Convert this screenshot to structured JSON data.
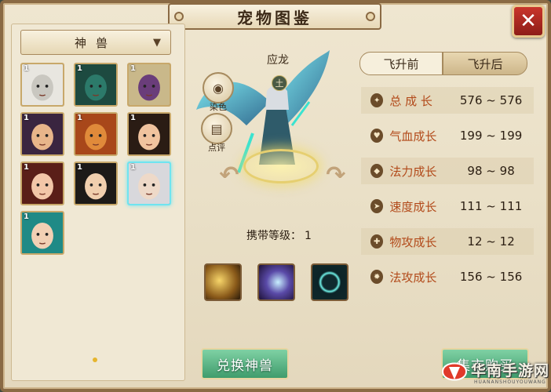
{
  "window": {
    "title": "宠物图鉴",
    "close_label": "✕"
  },
  "left": {
    "category": "神兽",
    "pets": [
      {
        "level": "1",
        "color": "#c9c7c0",
        "hair": "#e8e6e0"
      },
      {
        "level": "1",
        "color": "#2c7a6a",
        "hair": "#1d4a40"
      },
      {
        "level": "1",
        "color": "#6a3d7a",
        "hair": "#c9b88a"
      },
      {
        "level": "1",
        "color": "#e8b58a",
        "hair": "#3a2540"
      },
      {
        "level": "1",
        "color": "#e08a3a",
        "hair": "#a8471a"
      },
      {
        "level": "1",
        "color": "#f0c39e",
        "hair": "#2a1c14"
      },
      {
        "level": "1",
        "color": "#f2c6a8",
        "hair": "#5a1e18"
      },
      {
        "level": "1",
        "color": "#f1cfae",
        "hair": "#1d1a18"
      },
      {
        "level": "1",
        "color": "#eed9c8",
        "hair": "#d8d8dc",
        "selected": true
      },
      {
        "level": "1",
        "color": "#f2d0b4",
        "hair": "#1f8a86"
      }
    ]
  },
  "middle": {
    "pet_name": "应龙",
    "element_badge": "土",
    "dye_label": "染色",
    "review_label": "点评",
    "carry_label": "携带等级：",
    "carry_value": "1",
    "exchange_label": "兑换神兽",
    "market_label": "集市购买"
  },
  "right": {
    "tabs": [
      "飞升前",
      "飞升后"
    ],
    "active_tab": "飞升后",
    "stats": [
      {
        "name": "总 成 长",
        "min": "576",
        "sep": "~",
        "max": "576"
      },
      {
        "name": "气血成长",
        "min": "199",
        "sep": "~",
        "max": "199"
      },
      {
        "name": "法力成长",
        "min": "98",
        "sep": "~",
        "max": "98"
      },
      {
        "name": "速度成长",
        "min": "111",
        "sep": "~",
        "max": "111"
      },
      {
        "name": "物攻成长",
        "min": "12",
        "sep": "~",
        "max": "12"
      },
      {
        "name": "法攻成长",
        "min": "156",
        "sep": "~",
        "max": "156"
      }
    ]
  },
  "watermark": {
    "text": "华南手游网",
    "sub": "HUANANSHOUYOUWANG"
  },
  "colors": {
    "accent": "#b24a1a",
    "frame": "#8a6a44",
    "button_green": "#3f9c6c",
    "selection": "#6fe4f0"
  }
}
